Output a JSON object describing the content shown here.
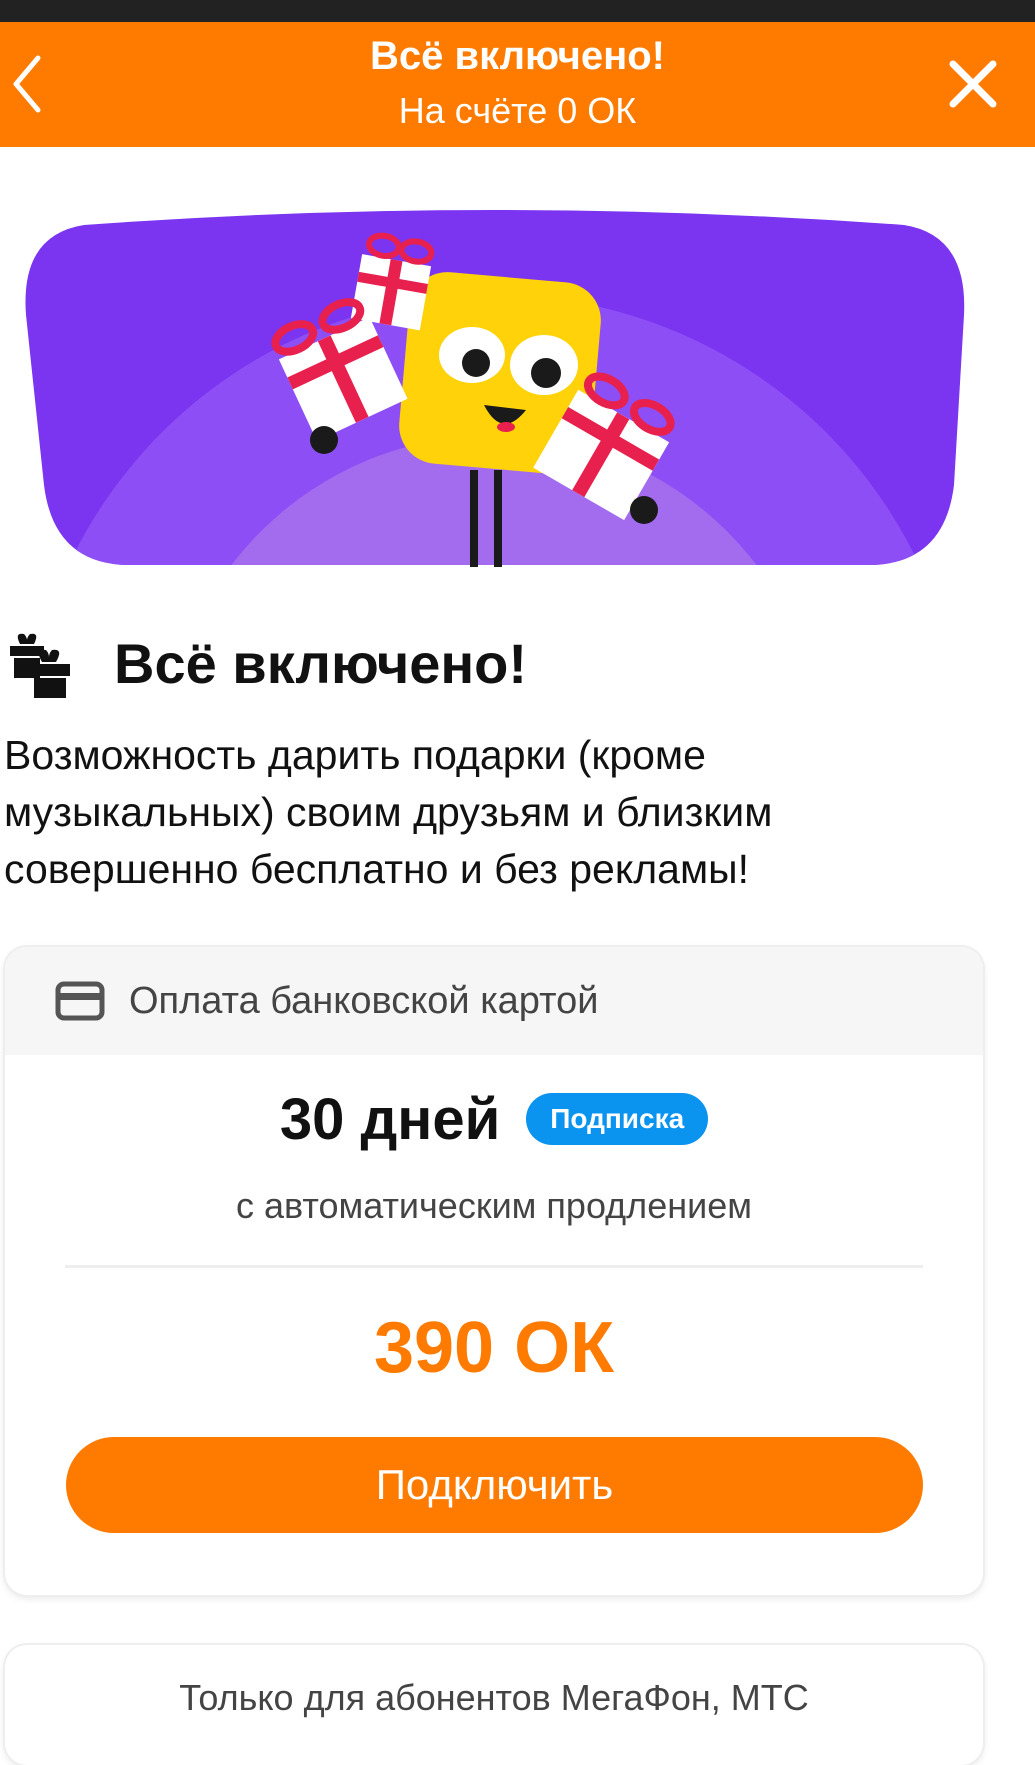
{
  "header": {
    "title": "Всё включено!",
    "subtitle": "На счёте 0 ОК",
    "back_icon": "chevron-left-icon",
    "close_icon": "close-icon"
  },
  "feature": {
    "icon": "gift-icon",
    "title": "Всё включено!",
    "description": "Возможность дарить подарки (кроме музыкальных) своим друзьям и близким совершенно бесплатно и без рекламы!"
  },
  "payment_card": {
    "method_icon": "credit-card-icon",
    "method_label": "Оплата банковской картой",
    "period": "30 дней",
    "badge": "Подписка",
    "renewal": "с автоматическим продлением",
    "price": "390 ОК",
    "button_label": "Подключить"
  },
  "second_card": {
    "text": "Только для абонентов МегаФон, МТС"
  },
  "colors": {
    "accent": "#ff7b00",
    "badge": "#0a93ef",
    "banner": "#8b4cf5"
  }
}
